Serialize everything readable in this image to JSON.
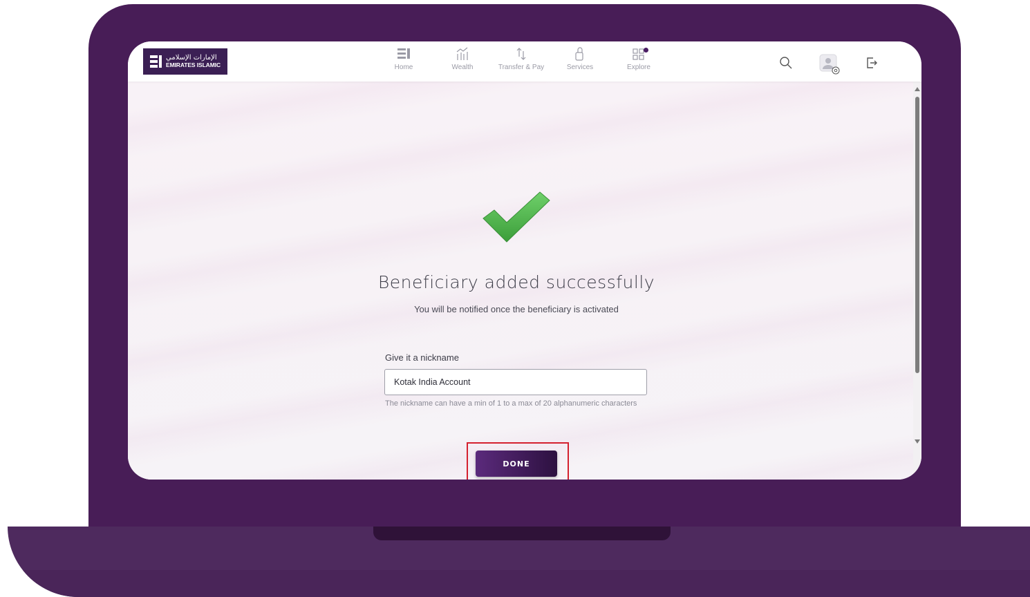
{
  "brand": {
    "name_en": "EMIRATES ISLAMIC",
    "name_ar": "الإمارات الإسلامي",
    "color": "#3b1f54"
  },
  "nav": {
    "items": [
      {
        "label": "Home",
        "icon": "home-icon"
      },
      {
        "label": "Wealth",
        "icon": "wealth-icon"
      },
      {
        "label": "Transfer & Pay",
        "icon": "transfer-icon"
      },
      {
        "label": "Services",
        "icon": "services-icon"
      },
      {
        "label": "Explore",
        "icon": "explore-icon"
      }
    ]
  },
  "toolbar": {
    "search_icon": "search-icon",
    "profile_icon": "profile-settings-icon",
    "logout_icon": "logout-icon"
  },
  "result": {
    "icon": "checkmark-icon",
    "title": "Beneficiary added successfully",
    "subtitle": "You will be notified once the beneficiary is activated"
  },
  "nickname": {
    "label": "Give it a nickname",
    "value": "Kotak India Account",
    "hint": "The nickname can have a min of 1 to a max of 20 alphanumeric characters"
  },
  "actions": {
    "done_label": "DONE"
  },
  "colors": {
    "laptop_frame": "#481d57",
    "accent": "#5b2a7c",
    "success": "#4caf50",
    "highlight": "#d4202e"
  }
}
